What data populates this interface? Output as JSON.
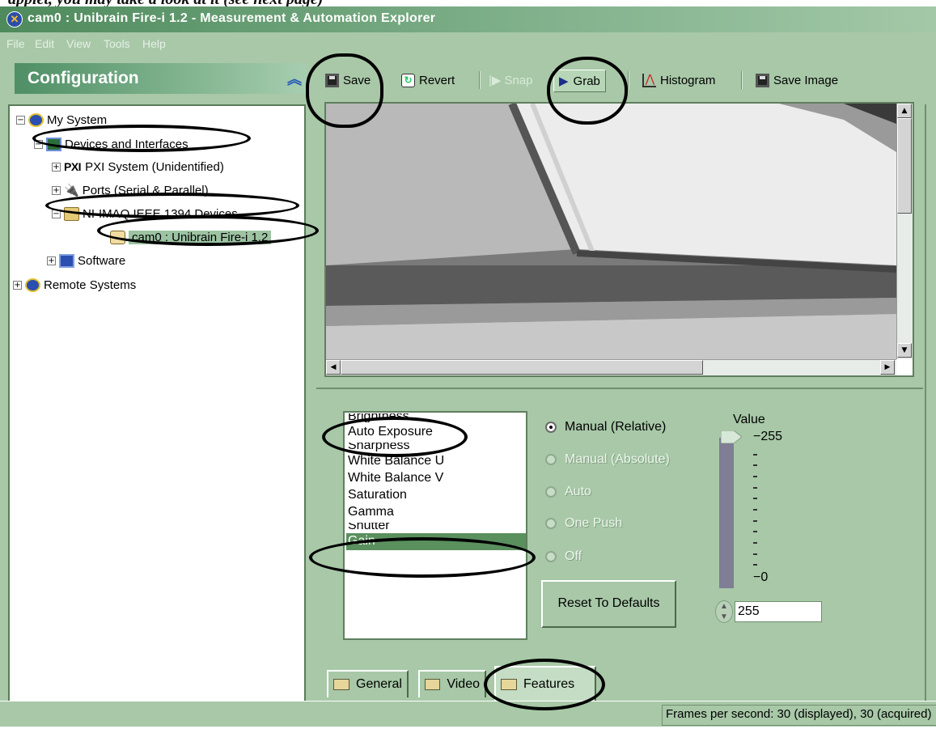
{
  "caption": {
    "text": "applet, you may take a look at it (see next page)"
  },
  "window": {
    "title": "cam0 : Unibrain Fire-i 1.2 - Measurement & Automation Explorer"
  },
  "menu": [
    "File",
    "Edit",
    "View",
    "Tools",
    "Help"
  ],
  "sidebar": {
    "title": "Configuration",
    "tree": [
      {
        "label": "My System"
      },
      {
        "label": "Devices and Interfaces"
      },
      {
        "label": "PXI System (Unidentified)",
        "prefix": "PXI"
      },
      {
        "label": "Ports (Serial & Parallel)"
      },
      {
        "label": "NI-IMAQ IEEE 1394 Devices"
      },
      {
        "label": "cam0 : Unibrain Fire-i 1.2"
      },
      {
        "label": "Software"
      },
      {
        "label": "Remote Systems"
      }
    ]
  },
  "toolbar": {
    "save": "Save",
    "revert": "Revert",
    "snap": "Snap",
    "grab": "Grab",
    "histogram": "Histogram",
    "save_image": "Save Image"
  },
  "features": {
    "list": [
      "Brightness",
      "Auto Exposure",
      "Sharpness",
      "White Balance U",
      "White Balance V",
      "Saturation",
      "Gamma",
      "Shutter",
      "Gain"
    ],
    "selected": "Gain",
    "modes": [
      {
        "label": "Manual (Relative)",
        "checked": true,
        "enabled": true
      },
      {
        "label": "Manual (Absolute)",
        "checked": false,
        "enabled": false
      },
      {
        "label": "Auto",
        "checked": false,
        "enabled": false
      },
      {
        "label": "One Push",
        "checked": false,
        "enabled": false
      },
      {
        "label": "Off",
        "checked": false,
        "enabled": false
      }
    ],
    "reset_label": "Reset To Defaults",
    "slider": {
      "label": "Value",
      "max_label": "255",
      "min_label": "0",
      "max": 255,
      "min": 0,
      "value": 255
    },
    "value_field": "255"
  },
  "tabs": [
    {
      "label": "General"
    },
    {
      "label": "Video"
    },
    {
      "label": "Features",
      "active": true
    }
  ],
  "status": {
    "text": "Frames per second: 30 (displayed), 30 (acquired)"
  },
  "colors": {
    "window_bg": "#a8c8a8",
    "selection": "#5a8f5e",
    "title_bar": "#4e8a5c",
    "annotation": "#000000"
  }
}
